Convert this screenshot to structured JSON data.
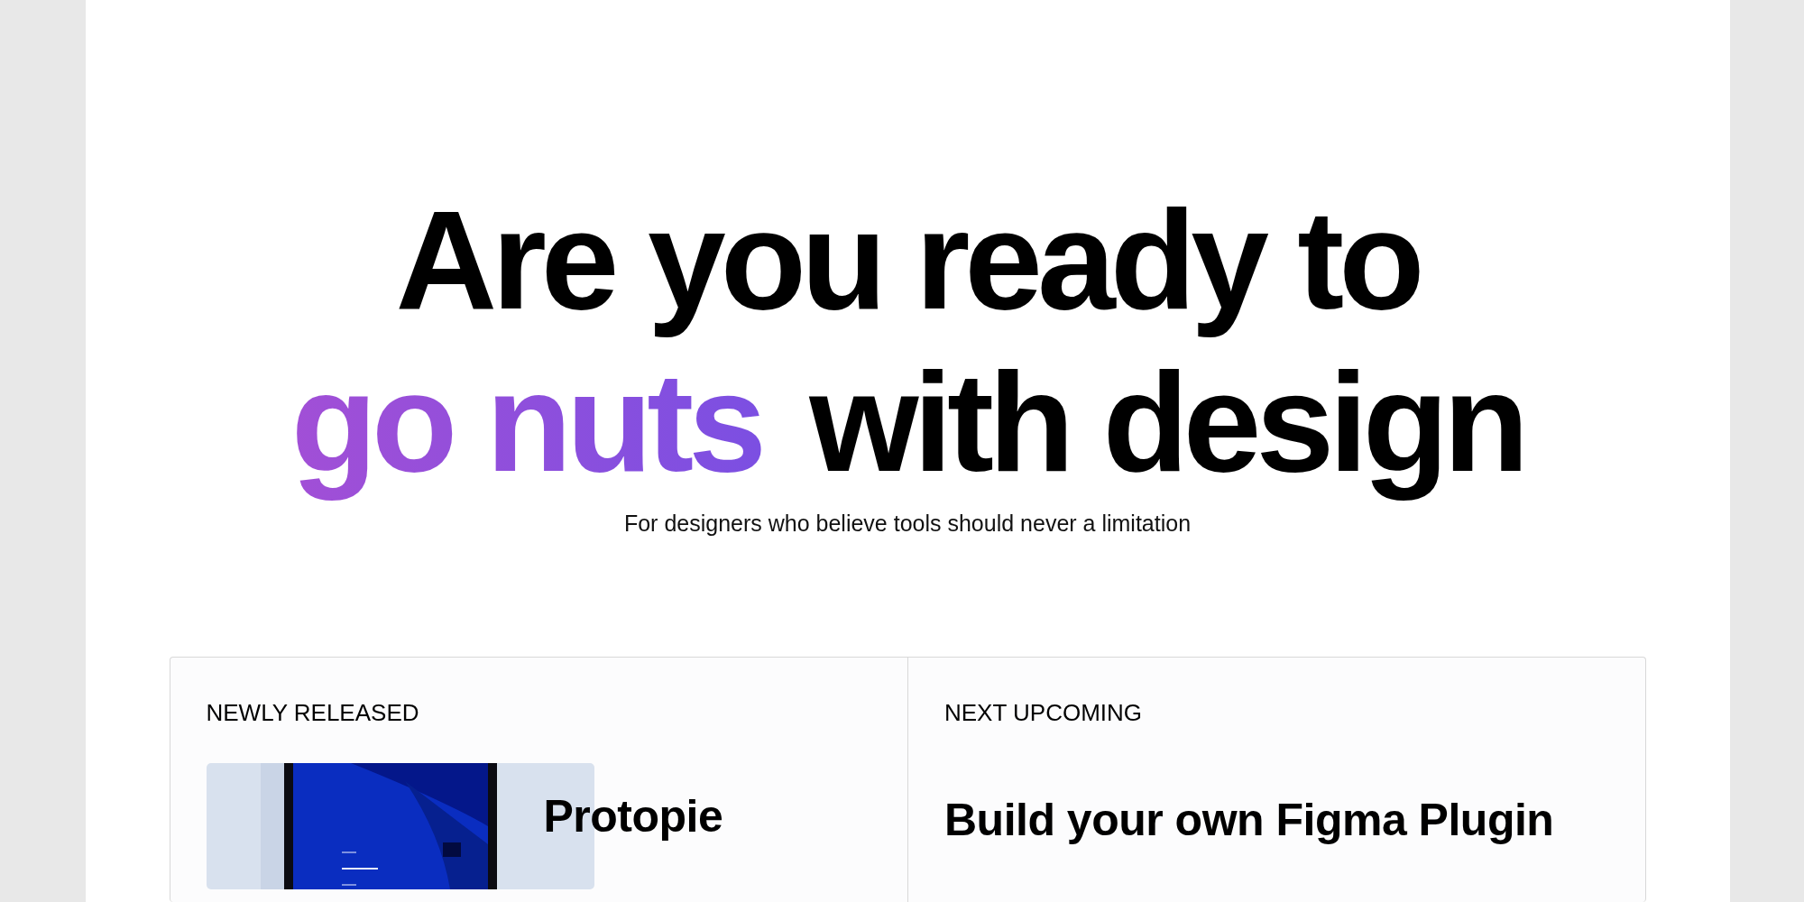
{
  "hero": {
    "headline": [
      [
        {
          "text": "Are you ready to",
          "accent": false
        }
      ],
      [
        {
          "text": "go nuts",
          "accent": true
        },
        {
          "text": " with design",
          "accent": false
        }
      ]
    ],
    "subtitle": "For designers who believe tools should never a limitation"
  },
  "panels": [
    {
      "label": "NEWLY RELEASED",
      "title": "Protopie"
    },
    {
      "label": "NEXT UPCOMING",
      "title": "Build your own Figma Plugin"
    }
  ]
}
